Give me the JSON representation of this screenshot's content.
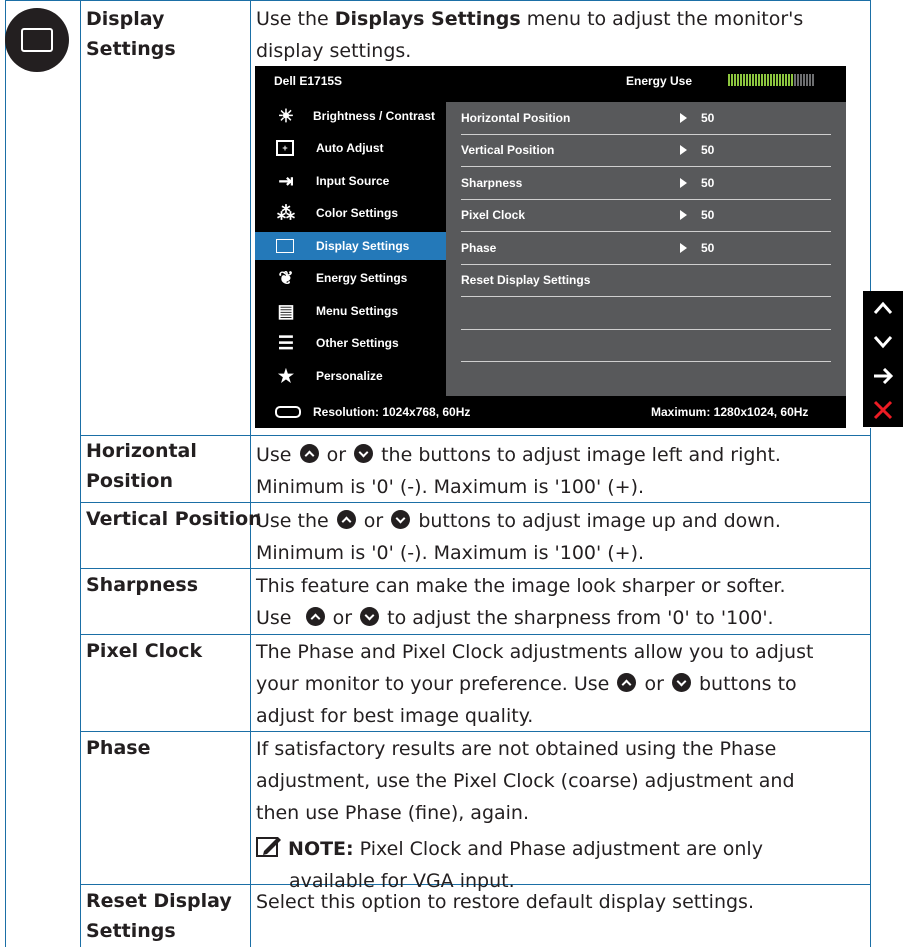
{
  "header": {
    "label_line1": "Display",
    "label_line2": "Settings",
    "intro_pre": "Use the ",
    "intro_bold": "Displays Settings",
    "intro_post": " menu to adjust the monitor's",
    "intro_line2": "display settings."
  },
  "osd": {
    "model": "Dell E1715S",
    "energy_label": "Energy Use",
    "menu_items": [
      {
        "label": "Brightness / Contrast",
        "icon": "brightness-icon"
      },
      {
        "label": "Auto Adjust",
        "icon": "auto-adjust-icon"
      },
      {
        "label": "Input Source",
        "icon": "input-source-icon"
      },
      {
        "label": "Color Settings",
        "icon": "color-settings-icon"
      },
      {
        "label": "Display Settings",
        "icon": "display-icon"
      },
      {
        "label": "Energy Settings",
        "icon": "energy-icon"
      },
      {
        "label": "Menu Settings",
        "icon": "menu-icon"
      },
      {
        "label": "Other Settings",
        "icon": "other-settings-icon"
      },
      {
        "label": "Personalize",
        "icon": "star-icon"
      }
    ],
    "selected_index": 4,
    "rows": [
      {
        "label": "Horizontal Position",
        "value": "50"
      },
      {
        "label": "Vertical Position",
        "value": "50"
      },
      {
        "label": "Sharpness",
        "value": "50"
      },
      {
        "label": "Pixel Clock",
        "value": "50"
      },
      {
        "label": "Phase",
        "value": "50"
      },
      {
        "label": "Reset Display Settings",
        "value": ""
      }
    ],
    "resolution": "Resolution: 1024x768, 60Hz",
    "maximum": "Maximum: 1280x1024, 60Hz",
    "colors": {
      "selected": "#2479b9",
      "panel": "#58595b",
      "energy": "#8dc63f"
    }
  },
  "nav_buttons": [
    "up-icon",
    "down-icon",
    "right-arrow-icon",
    "close-icon"
  ],
  "rows": {
    "horizontal": {
      "label_line1": "Horizontal",
      "label_line2": "Position",
      "line1_a": "Use ",
      "line1_b": " or ",
      "line1_c": " the buttons to adjust image left and right.",
      "line2": "Minimum is '0' (-). Maximum is '100' (+)."
    },
    "vertical": {
      "label": "Vertical Position",
      "line1_a": "Use the ",
      "line1_b": " or ",
      "line1_c": " buttons to adjust image up and down.",
      "line2": "Minimum is '0' (-). Maximum is '100' (+)."
    },
    "sharpness": {
      "label": "Sharpness",
      "line1": "This feature can make the image look sharper or softer.",
      "line2_a": "Use  ",
      "line2_b": " or ",
      "line2_c": " to adjust the sharpness from '0' to '100'."
    },
    "pixel_clock": {
      "label": "Pixel Clock",
      "line1": "The Phase and Pixel Clock adjustments allow you to adjust",
      "line2_a": "your monitor to your preference. Use ",
      "line2_b": " or ",
      "line2_c": " buttons to",
      "line3": "adjust for best image quality."
    },
    "phase": {
      "label": "Phase",
      "line1": "If satisfactory results are not obtained using the Phase",
      "line2": "adjustment, use the Pixel Clock (coarse) adjustment and",
      "line3": "then use Phase (fine), again.",
      "note_label": "NOTE:",
      "note_line1": " Pixel Clock and Phase adjustment are only",
      "note_line2": "available for VGA input."
    },
    "reset": {
      "label_line1": "Reset Display",
      "label_line2": "Settings",
      "line1": "Select this option to restore default display settings."
    }
  }
}
